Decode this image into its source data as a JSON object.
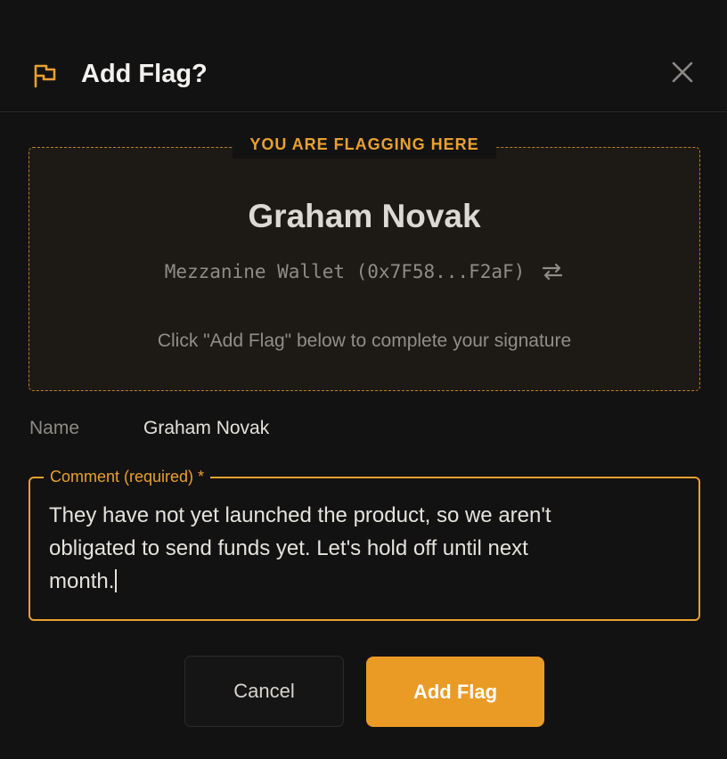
{
  "dialog": {
    "title": "Add Flag?",
    "close_icon": "close-icon",
    "flag_icon": "flag-icon"
  },
  "flag_target": {
    "legend": "YOU ARE FLAGGING HERE",
    "person_name": "Graham Novak",
    "wallet": "Mezzanine Wallet (0x7F58...F2aF)",
    "swap_icon": "swap-icon",
    "instruction": "Click \"Add Flag\" below to complete your signature"
  },
  "name_field": {
    "label": "Name",
    "value": "Graham Novak"
  },
  "comment": {
    "label": "Comment (required) *",
    "value": "They have not yet launched the product, so we aren't\nobligated to send funds yet. Let's hold off until next\nmonth."
  },
  "buttons": {
    "cancel": "Cancel",
    "add_flag": "Add Flag"
  },
  "colors": {
    "accent": "#e99b25",
    "background": "#131212",
    "panel": "#1d1915"
  }
}
